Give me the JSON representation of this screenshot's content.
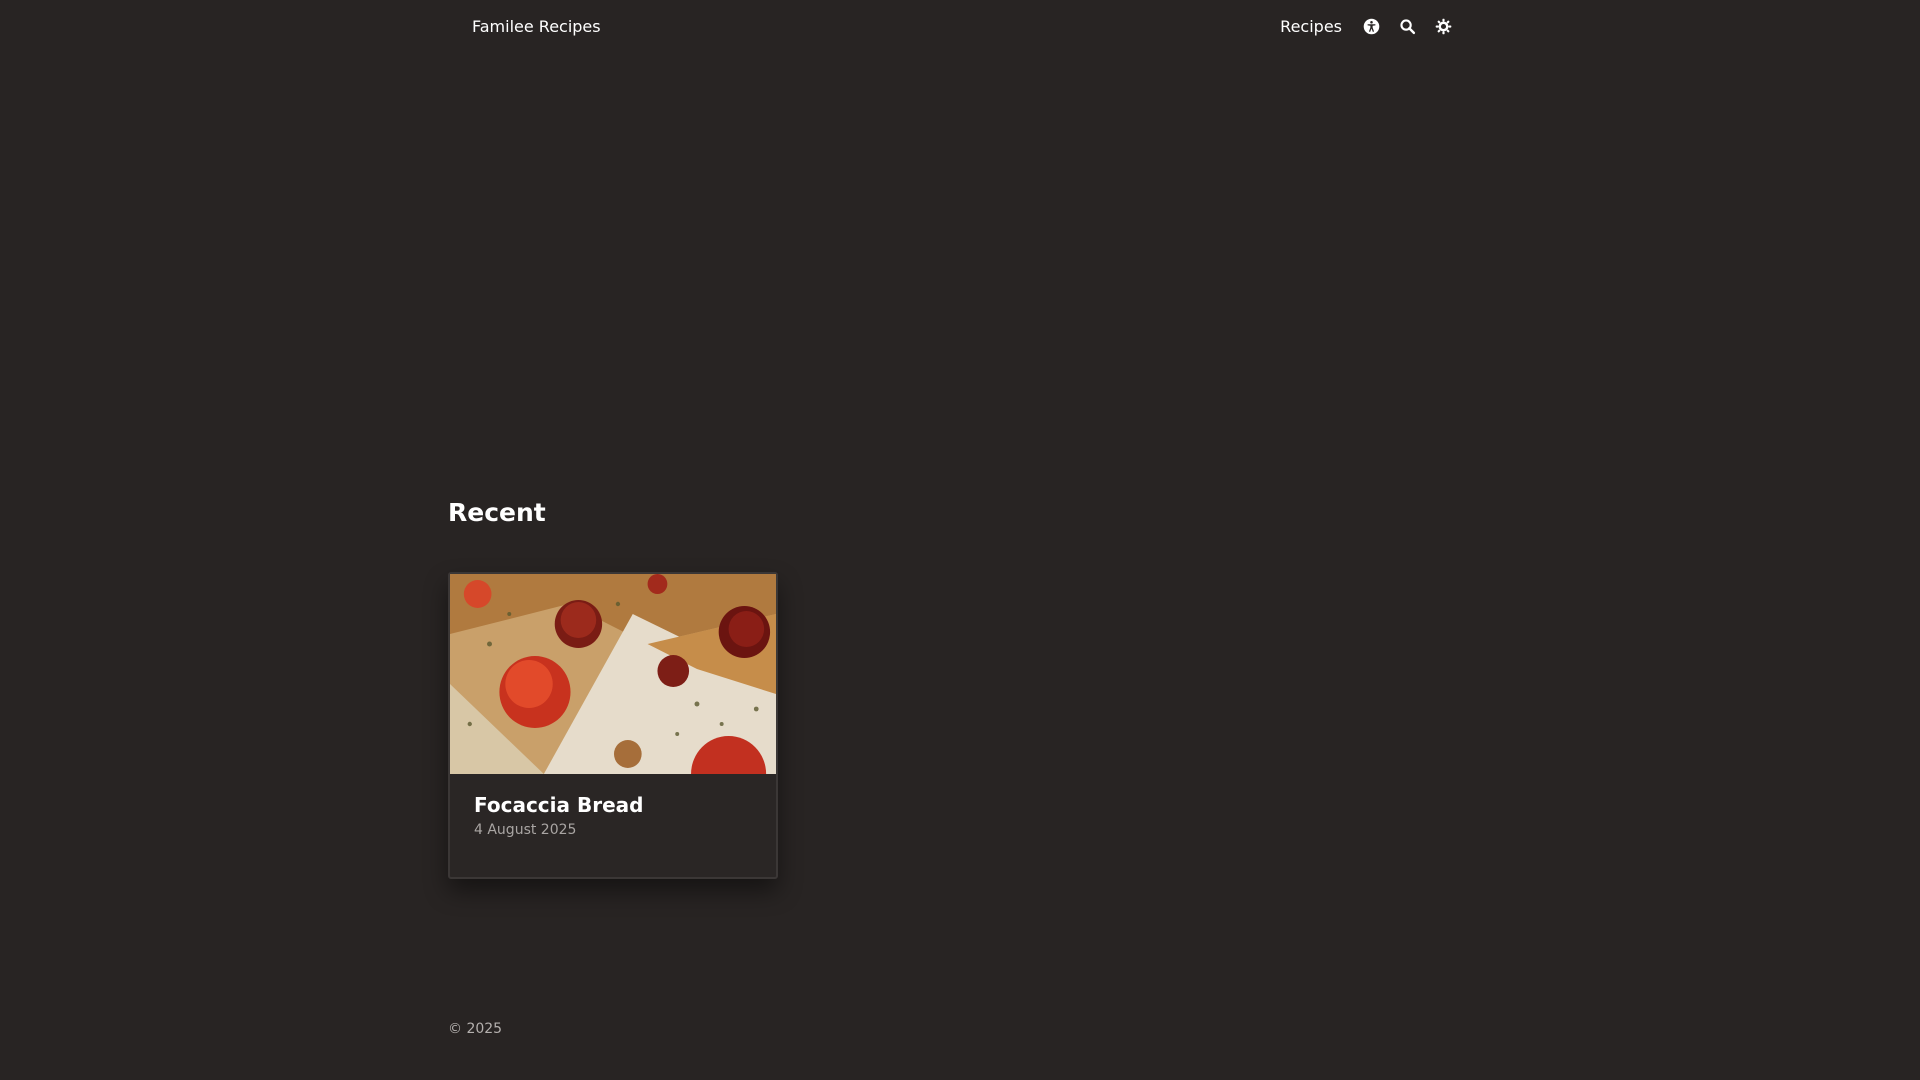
{
  "header": {
    "site_title": "Familee Recipes",
    "nav": {
      "recipes_label": "Recipes"
    },
    "icons": [
      "accessibility-icon",
      "search-icon",
      "theme-toggle-icon"
    ]
  },
  "main": {
    "section_title": "Recent",
    "cards": [
      {
        "title": "Focaccia Bread",
        "date": "4 August 2025"
      }
    ]
  },
  "footer": {
    "copyright": "© 2025"
  },
  "colors": {
    "background": "#282423",
    "text": "#ffffff",
    "muted_text": "#a9a5a3"
  }
}
